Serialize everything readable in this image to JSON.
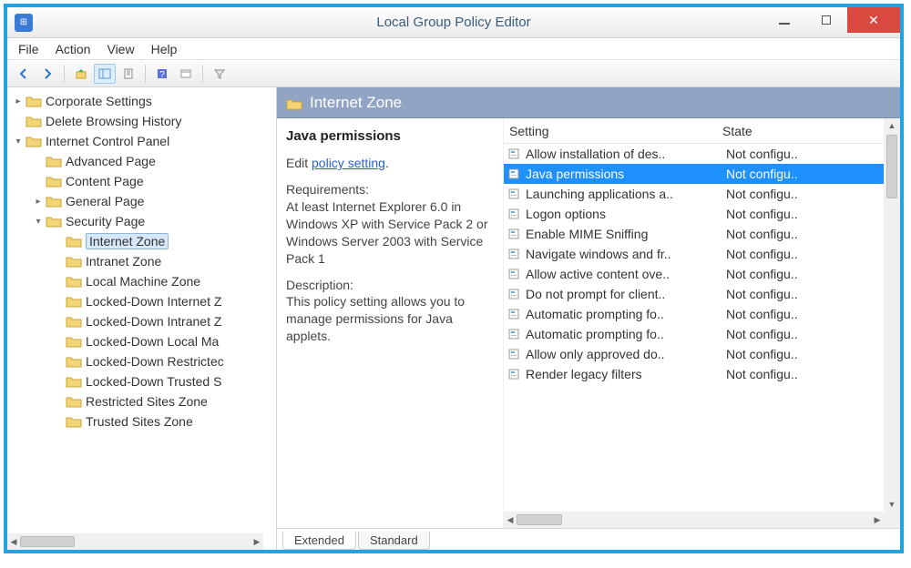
{
  "window": {
    "title": "Local Group Policy Editor"
  },
  "menu": {
    "file": "File",
    "action": "Action",
    "view": "View",
    "help": "Help"
  },
  "tree": [
    {
      "depth": 1,
      "twisty": "▸",
      "label": "Corporate Settings"
    },
    {
      "depth": 1,
      "twisty": "",
      "label": "Delete Browsing History"
    },
    {
      "depth": 1,
      "twisty": "▾",
      "label": "Internet Control Panel"
    },
    {
      "depth": 2,
      "twisty": "",
      "label": "Advanced Page"
    },
    {
      "depth": 2,
      "twisty": "",
      "label": "Content Page"
    },
    {
      "depth": 2,
      "twisty": "▸",
      "label": "General Page"
    },
    {
      "depth": 2,
      "twisty": "▾",
      "label": "Security Page"
    },
    {
      "depth": 3,
      "twisty": "",
      "label": "Internet Zone",
      "selected": true
    },
    {
      "depth": 3,
      "twisty": "",
      "label": "Intranet Zone"
    },
    {
      "depth": 3,
      "twisty": "",
      "label": "Local Machine Zone"
    },
    {
      "depth": 3,
      "twisty": "",
      "label": "Locked-Down Internet Z"
    },
    {
      "depth": 3,
      "twisty": "",
      "label": "Locked-Down Intranet Z"
    },
    {
      "depth": 3,
      "twisty": "",
      "label": "Locked-Down Local Ma"
    },
    {
      "depth": 3,
      "twisty": "",
      "label": "Locked-Down Restrictec"
    },
    {
      "depth": 3,
      "twisty": "",
      "label": "Locked-Down Trusted S"
    },
    {
      "depth": 3,
      "twisty": "",
      "label": "Restricted Sites Zone"
    },
    {
      "depth": 3,
      "twisty": "",
      "label": "Trusted Sites Zone"
    }
  ],
  "zone_title": "Internet Zone",
  "desc": {
    "title": "Java permissions",
    "edit_prefix": "Edit ",
    "edit_link": "policy setting",
    "req_label": "Requirements:",
    "req_text": "At least Internet Explorer 6.0 in Windows XP with Service Pack 2 or Windows Server 2003 with Service Pack 1",
    "desc_label": "Description:",
    "desc_text": "This policy setting allows you to manage permissions for Java applets."
  },
  "columns": {
    "c1": "Setting",
    "c2": "State"
  },
  "rows": [
    {
      "name": "Allow installation of des..",
      "state": "Not configu.."
    },
    {
      "name": "Java permissions",
      "state": "Not configu..",
      "selected": true
    },
    {
      "name": "Launching applications a..",
      "state": "Not configu.."
    },
    {
      "name": "Logon options",
      "state": "Not configu.."
    },
    {
      "name": "Enable MIME Sniffing",
      "state": "Not configu.."
    },
    {
      "name": "Navigate windows and fr..",
      "state": "Not configu.."
    },
    {
      "name": "Allow active content ove..",
      "state": "Not configu.."
    },
    {
      "name": "Do not prompt for client..",
      "state": "Not configu.."
    },
    {
      "name": "Automatic prompting fo..",
      "state": "Not configu.."
    },
    {
      "name": "Automatic prompting fo..",
      "state": "Not configu.."
    },
    {
      "name": "Allow only approved do..",
      "state": "Not configu.."
    },
    {
      "name": "Render legacy filters",
      "state": "Not configu.."
    }
  ],
  "tabs": {
    "extended": "Extended",
    "standard": "Standard"
  }
}
